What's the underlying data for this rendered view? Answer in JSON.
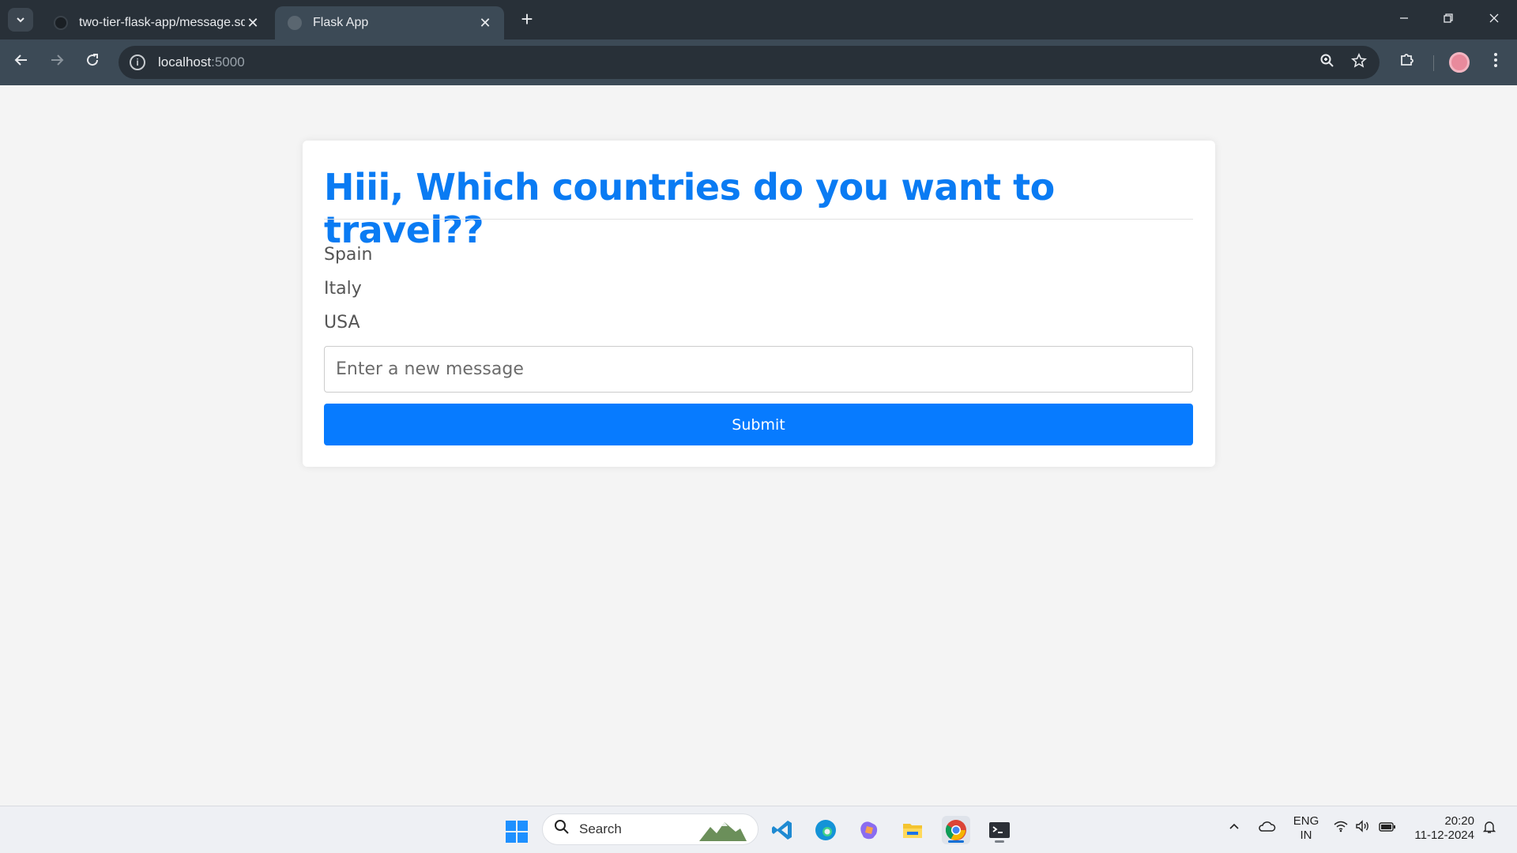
{
  "browser": {
    "tabs": [
      {
        "title": "two-tier-flask-app/message.sql",
        "close": "✕"
      },
      {
        "title": "Flask App",
        "close": "✕"
      }
    ],
    "new_tab": "+",
    "url_host": "localhost",
    "url_port": ":5000"
  },
  "page": {
    "heading": "Hiii, Which countries do you want to travel??",
    "messages": [
      "Spain",
      "Italy",
      "USA"
    ],
    "input_placeholder": "Enter a new message",
    "submit_label": "Submit"
  },
  "taskbar": {
    "search_label": "Search",
    "language": "ENG",
    "region": "IN",
    "time": "20:20",
    "date": "11-12-2024"
  },
  "colors": {
    "accent": "#077bff",
    "heading": "#0a7bf3"
  }
}
